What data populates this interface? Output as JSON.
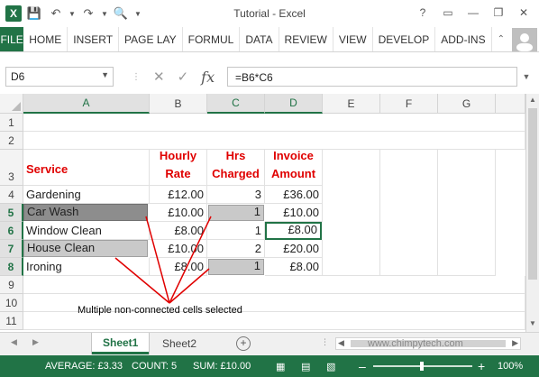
{
  "window": {
    "title": "Tutorial - Excel",
    "help": "?"
  },
  "ribbon": {
    "file": "FILE",
    "tabs": [
      "HOME",
      "INSERT",
      "PAGE LAY",
      "FORMUL",
      "DATA",
      "REVIEW",
      "VIEW",
      "DEVELOP",
      "ADD-INS"
    ]
  },
  "formula_bar": {
    "name_box": "D6",
    "formula": "=B6*C6"
  },
  "grid": {
    "columns": [
      "A",
      "B",
      "C",
      "D",
      "E",
      "F",
      "G"
    ],
    "rows": [
      "1",
      "2",
      "3",
      "4",
      "5",
      "6",
      "7",
      "8",
      "9",
      "10",
      "11"
    ],
    "headers": {
      "service": "Service",
      "rate": [
        "Hourly",
        "Rate"
      ],
      "hours": [
        "Hrs",
        "Charged"
      ],
      "invoice": [
        "Invoice",
        "Amount"
      ]
    },
    "data": [
      {
        "service": "Gardening",
        "rate": "£12.00",
        "hours": "3",
        "amount": "£36.00"
      },
      {
        "service": "Car Wash",
        "rate": "£10.00",
        "hours": "1",
        "amount": "£10.00"
      },
      {
        "service": "Window Clean",
        "rate": "£8.00",
        "hours": "1",
        "amount": "£8.00"
      },
      {
        "service": "House Clean",
        "rate": "£10.00",
        "hours": "2",
        "amount": "£20.00"
      },
      {
        "service": "Ironing",
        "rate": "£8.00",
        "hours": "1",
        "amount": "£8.00"
      }
    ],
    "annotation": "Multiple non-connected cells selected"
  },
  "sheets": {
    "tabs": [
      "Sheet1",
      "Sheet2"
    ],
    "active": "Sheet1",
    "watermark": "www.chimpytech.com"
  },
  "status": {
    "average": "AVERAGE: £3.33",
    "count": "COUNT: 5",
    "sum": "SUM: £10.00",
    "zoom": "100%"
  },
  "colors": {
    "accent": "#217346",
    "header_text": "#e00000"
  }
}
